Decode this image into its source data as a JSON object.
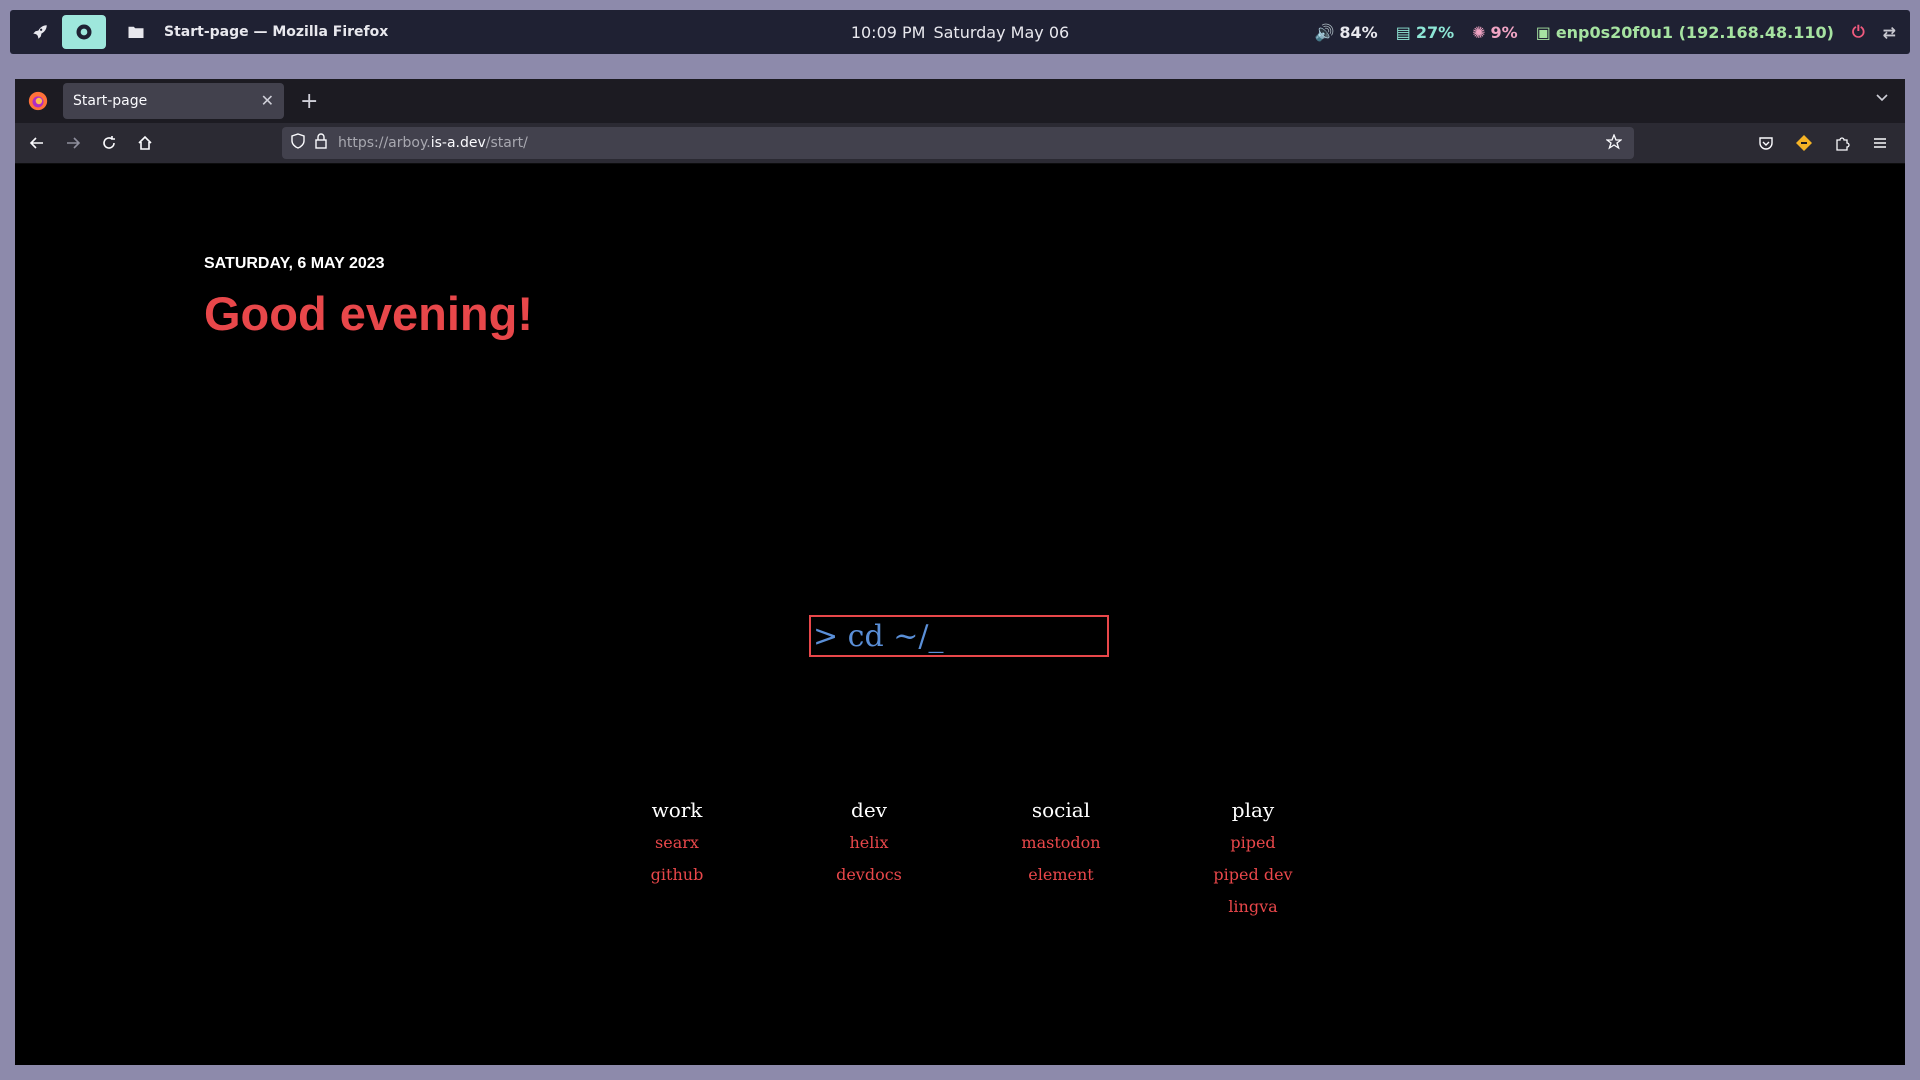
{
  "topbar": {
    "window_title": "Start-page — Mozilla Firefox",
    "time": "10:09 PM",
    "date": "Saturday May 06",
    "status": {
      "volume": "84%",
      "memory": "27%",
      "cpu": "9%",
      "network": "enp0s20f0u1 (192.168.48.110)"
    },
    "icons": [
      "rocket-icon",
      "firefox-app-icon",
      "folder-icon",
      "volume-icon",
      "memory-icon",
      "cpu-icon",
      "network-icon",
      "power-icon",
      "exit-icon"
    ]
  },
  "browser": {
    "tab_title": "Start-page",
    "url_prefix": "https://arboy.",
    "url_domain": "is-a.dev",
    "url_suffix": "/start/"
  },
  "page": {
    "date_line": "SATURDAY, 6 MAY 2023",
    "greeting": "Good evening!",
    "prompt_value": "> cd ~/_",
    "columns": [
      {
        "title": "work",
        "links": [
          "searx",
          "github"
        ]
      },
      {
        "title": "dev",
        "links": [
          "helix",
          "devdocs"
        ]
      },
      {
        "title": "social",
        "links": [
          "mastodon",
          "element"
        ]
      },
      {
        "title": "play",
        "links": [
          "piped",
          "piped dev",
          "lingva"
        ]
      }
    ]
  },
  "colors": {
    "accent_red": "#e8474a",
    "prompt_blue": "#5a8fd8",
    "desktop_bg": "#8d8aab",
    "topbar_bg": "#1f2133"
  }
}
